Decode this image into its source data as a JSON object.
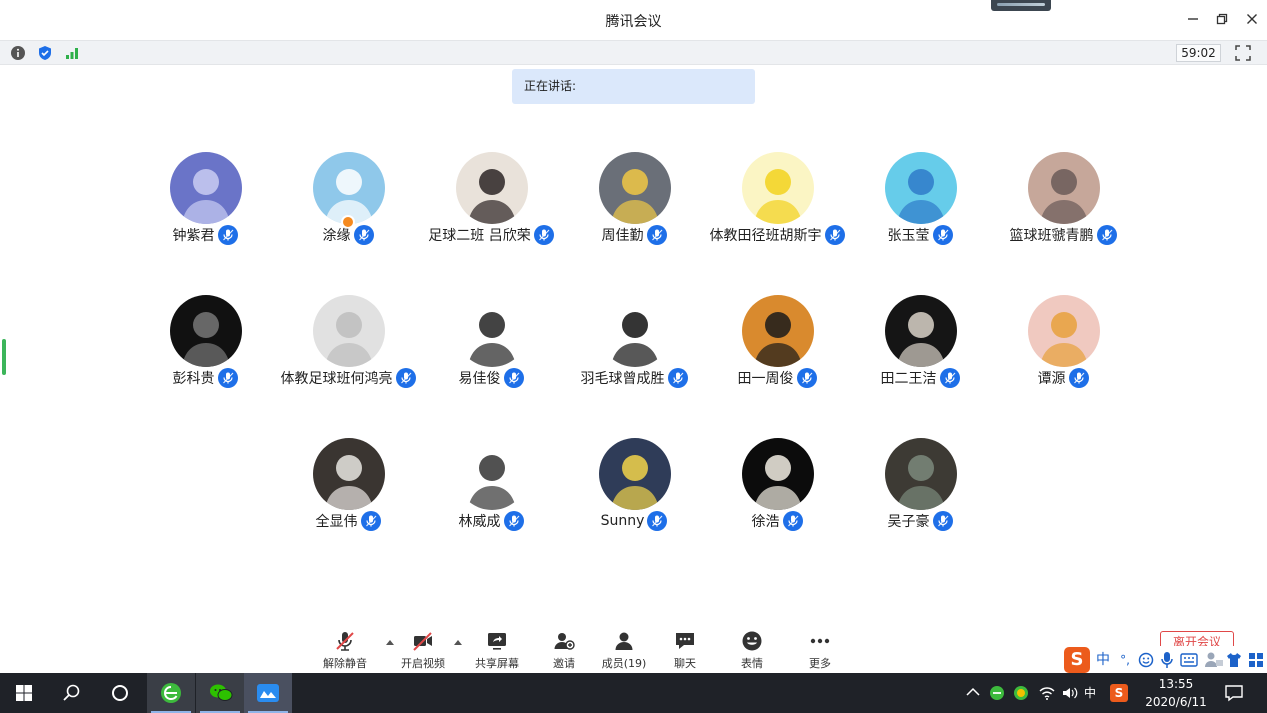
{
  "window": {
    "title": "腾讯会议"
  },
  "infobar": {
    "timer": "59:02"
  },
  "speaking": {
    "label": "正在讲话:"
  },
  "participants": [
    {
      "name": "钟紫君",
      "bg": "#6a74c8",
      "fg": "#c9cdf2"
    },
    {
      "name": "涂缘",
      "bg": "#8fc8ea",
      "fg": "#ffffff"
    },
    {
      "name": "足球二班 吕欣荣",
      "bg": "#e9e2da",
      "fg": "#2b2424"
    },
    {
      "name": "周佳勤",
      "bg": "#6a6f78",
      "fg": "#f0c844"
    },
    {
      "name": "体教田径班胡斯宇",
      "bg": "#fbf5c4",
      "fg": "#f2d21e"
    },
    {
      "name": "张玉莹",
      "bg": "#66ccea",
      "fg": "#2f7ac9"
    },
    {
      "name": "篮球班虢青鹏",
      "bg": "#c6a79a",
      "fg": "#6a5a58"
    },
    {
      "name": "彭科贵",
      "bg": "#111111",
      "fg": "#777777"
    },
    {
      "name": "体教足球班何鸿亮",
      "bg": "#e1e1e1",
      "fg": "#bdbdbd"
    },
    {
      "name": "易佳俊",
      "bg": "#ffffff",
      "fg": "#222222"
    },
    {
      "name": "羽毛球曾成胜",
      "bg": "#ffffff",
      "fg": "#111111"
    },
    {
      "name": "田一周俊",
      "bg": "#d98a2e",
      "fg": "#1a1a1a"
    },
    {
      "name": "田二王洁",
      "bg": "#151515",
      "fg": "#d9d2c8"
    },
    {
      "name": "谭源",
      "bg": "#f0c9c0",
      "fg": "#e7a13c"
    },
    {
      "name": "全显伟",
      "bg": "#3a3531",
      "fg": "#e9e6e2"
    },
    {
      "name": "林威成",
      "bg": "#ffffff",
      "fg": "#333333"
    },
    {
      "name": "Sunny",
      "bg": "#2f3c58",
      "fg": "#f2d44a"
    },
    {
      "name": "徐浩",
      "bg": "#0c0c0c",
      "fg": "#f3efe4"
    },
    {
      "name": "吴子豪",
      "bg": "#3d3a34",
      "fg": "#7b8a7c"
    }
  ],
  "toolbar": {
    "unmute": "解除静音",
    "video": "开启视频",
    "share": "共享屏幕",
    "invite": "邀请",
    "members": "成员(19)",
    "chat": "聊天",
    "emoji": "表情",
    "more": "更多",
    "leave": "离开会议"
  },
  "ime": {
    "mode": "中",
    "punct": "°,"
  },
  "taskbar": {
    "time": "13:55",
    "date": "2020/6/11",
    "ime_mode": "中"
  },
  "colors": {
    "accent": "#1e6fe8",
    "leave": "#e04848",
    "taskbar": "#1f2228"
  }
}
